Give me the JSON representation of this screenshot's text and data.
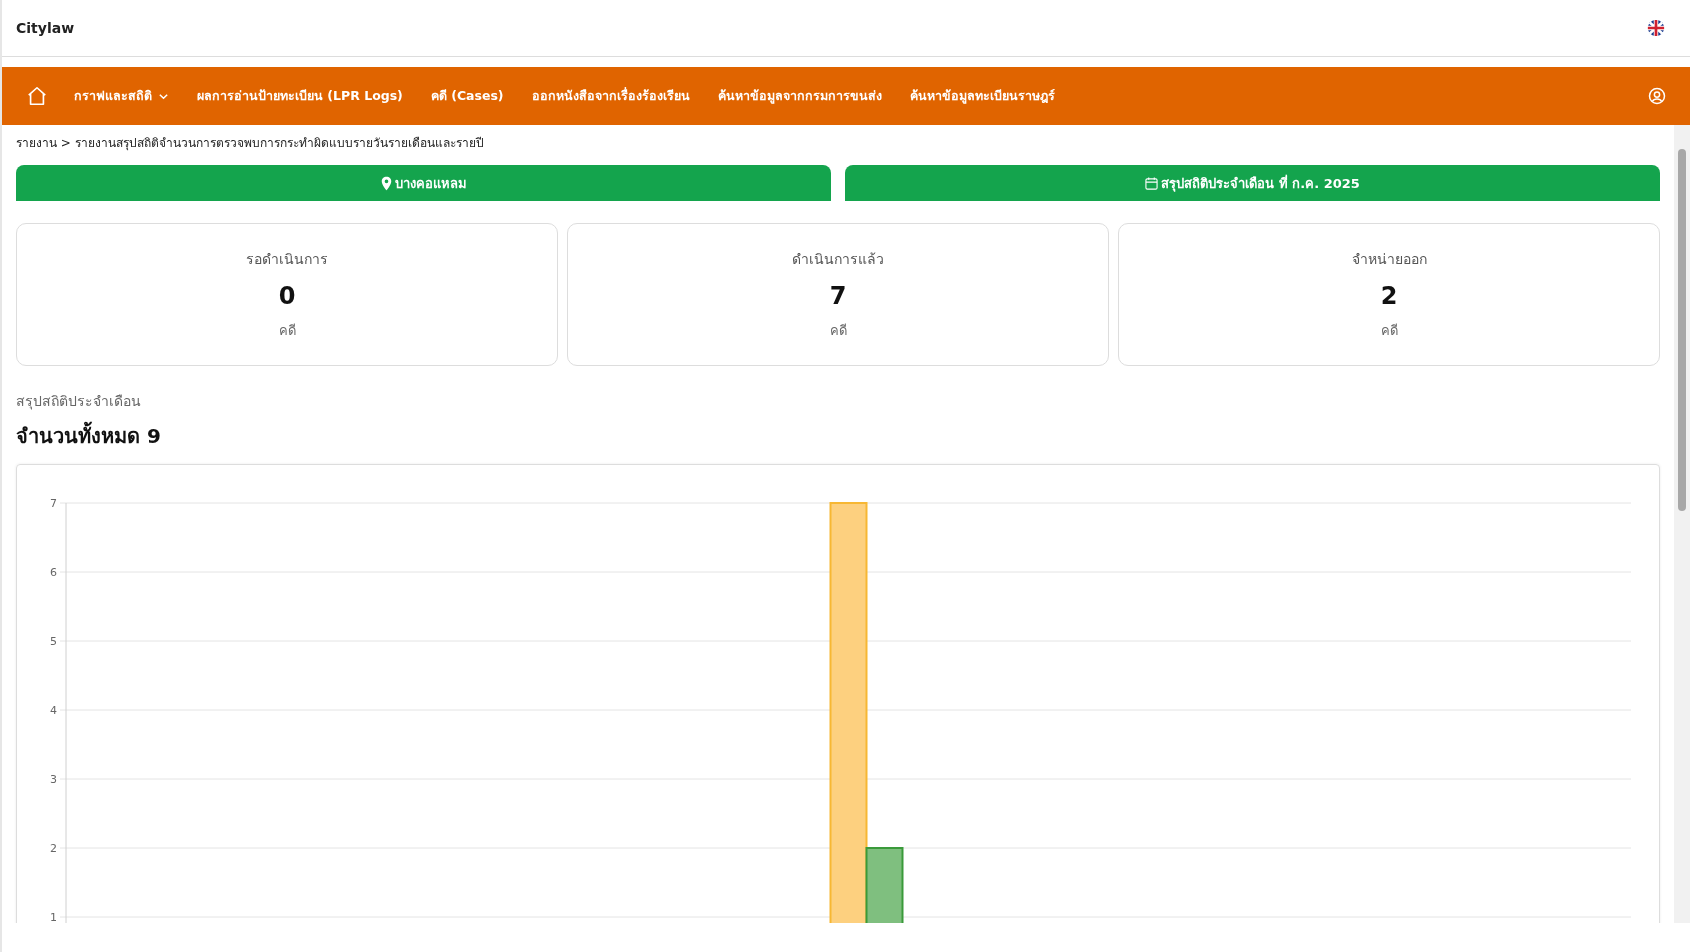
{
  "header": {
    "brand": "Citylaw"
  },
  "nav": {
    "items": [
      {
        "label": "กราฟและสถิติ",
        "kind": "dropdown"
      },
      {
        "label": "ผลการอ่านป้ายทะเบียน (LPR Logs)",
        "kind": "link"
      },
      {
        "label": "คดี (Cases)",
        "kind": "link"
      },
      {
        "label": "ออกหนังสือจากเรื่องร้องเรียน",
        "kind": "link"
      },
      {
        "label": "ค้นหาข้อมูลจากกรมการขนส่ง",
        "kind": "link"
      },
      {
        "label": "ค้นหาข้อมูลทะเบียนราษฎร์",
        "kind": "link"
      }
    ]
  },
  "breadcrumb": "รายงาน > รายงานสรุปสถิติจำนวนการตรวจพบการกระทำผิดแบบรายวันรายเดือนและรายปี",
  "filters": [
    {
      "kind": "location",
      "label": "บางคอแหลม"
    },
    {
      "kind": "calendar",
      "label": "สรุปสถิติประจำเดือน ที่ ก.ค. 2025"
    }
  ],
  "cards": [
    {
      "title": "รอดำเนินการ",
      "value": "0",
      "unit": "คดี"
    },
    {
      "title": "ดำเนินการแล้ว",
      "value": "7",
      "unit": "คดี"
    },
    {
      "title": "จำหน่ายออก",
      "value": "2",
      "unit": "คดี"
    }
  ],
  "summary": {
    "subtitle": "สรุปสถิติประจำเดือน",
    "heading": "จำนวนทั้งหมด 9"
  },
  "chart": {
    "chart_data": {
      "type": "bar",
      "grid": true,
      "ylim": [
        0,
        7
      ],
      "yticks": [
        1,
        2,
        3,
        4,
        5,
        6,
        7
      ],
      "series": [
        {
          "color": "#fdd07f",
          "values": [
            null,
            null,
            null,
            null,
            null,
            7,
            null,
            null,
            null,
            null,
            null
          ]
        },
        {
          "color": "#7fbf7f",
          "values": [
            null,
            null,
            null,
            null,
            null,
            2,
            null,
            null,
            null,
            null,
            null
          ]
        }
      ]
    }
  }
}
